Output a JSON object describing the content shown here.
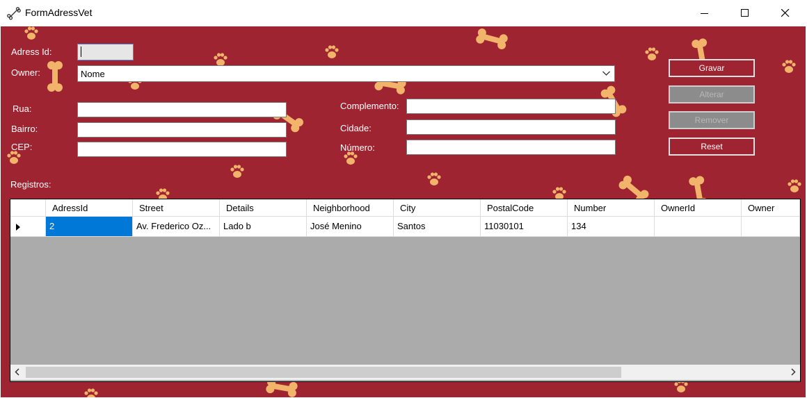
{
  "window": {
    "title": "FormAdressVet"
  },
  "form": {
    "adress_id_label": "Adress Id:",
    "adress_id_value": "",
    "owner_label": "Owner:",
    "owner_value": "Nome",
    "rua_label": "Rua:",
    "rua_value": "",
    "bairro_label": "Bairro:",
    "bairro_value": "",
    "cep_label": "CEP:",
    "cep_value": "",
    "complemento_label": "Complemento:",
    "complemento_value": "",
    "cidade_label": "Cidade:",
    "cidade_value": "",
    "numero_label": "Número:",
    "numero_value": "",
    "registros_label": "Registros:"
  },
  "buttons": {
    "gravar": "Gravar",
    "alterar": "Alterar",
    "remover": "Remover",
    "reset": "Reset"
  },
  "grid": {
    "columns": [
      "AdressId",
      "Street",
      "Details",
      "Neighborhood",
      "City",
      "PostalCode",
      "Number",
      "OwnerId",
      "Owner"
    ],
    "rows": [
      [
        "2",
        "Av. Frederico Oz...",
        "Lado b",
        "José Menino",
        "Santos",
        "11030101",
        "134",
        "",
        ""
      ]
    ]
  },
  "colors": {
    "background": "#9e2431",
    "bone": "#f2b36b",
    "selection": "#0078d7"
  }
}
